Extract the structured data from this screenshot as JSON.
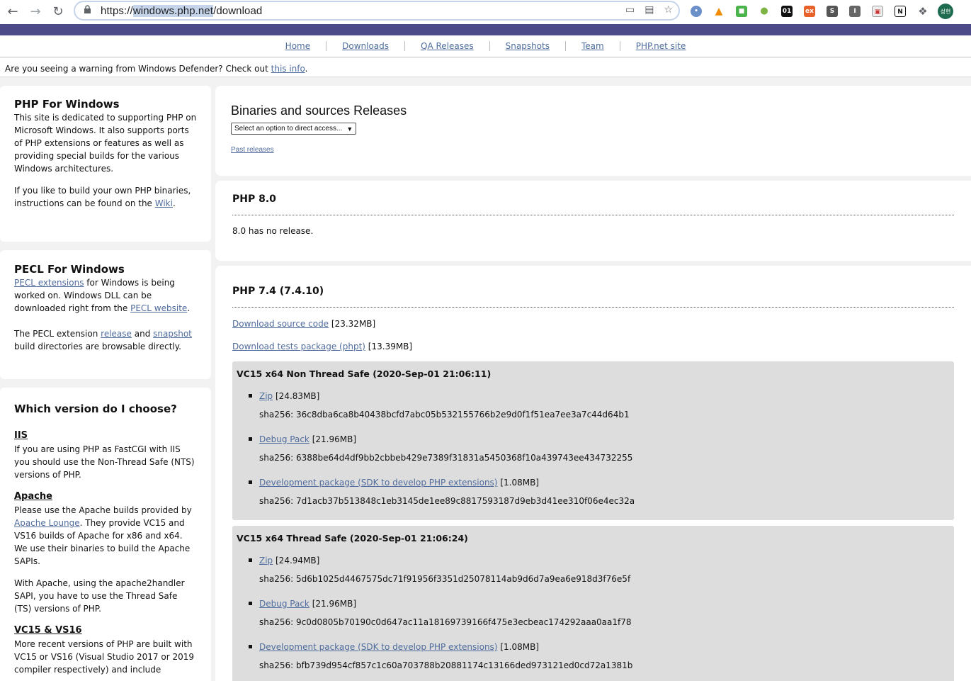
{
  "browser": {
    "url_prefix": "https://",
    "url_host": "windows.php.net",
    "url_path": "/download",
    "avatar_text": "성현",
    "icons": [
      "back-icon",
      "forward-icon",
      "reload-icon",
      "lock-icon",
      "cast-icon",
      "translate-icon",
      "star-icon",
      "extensions-icon"
    ]
  },
  "nav": {
    "items": [
      "Home",
      "Downloads",
      "QA Releases",
      "Snapshots",
      "Team",
      "PHP.net site"
    ]
  },
  "notice": {
    "text": "Are you seeing a warning from Windows Defender? Check out ",
    "link": "this info",
    "end": "."
  },
  "sidebar": {
    "php_windows": {
      "title": "PHP For Windows",
      "p1": "This site is dedicated to supporting PHP on Microsoft Windows. It also supports ports of PHP extensions or features as well as providing special builds for the various Windows architectures.",
      "p2_a": "If you like to build your own PHP binaries, instructions can be found on the ",
      "p2_link": "Wiki",
      "p2_b": "."
    },
    "pecl": {
      "title": "PECL For Windows",
      "p1_link1": "PECL extensions",
      "p1_a": " for Windows is being worked on. Windows DLL can be downloaded right from the ",
      "p1_link2": "PECL website",
      "p1_b": ".",
      "p2_a": "The PECL extension ",
      "p2_link1": "release",
      "p2_mid": " and ",
      "p2_link2": "snapshot",
      "p2_b": " build directories are browsable directly."
    },
    "choose": {
      "title": "Which version do I choose?",
      "iis_title": "IIS",
      "iis_text": "If you are using PHP as FastCGI with IIS you should use the Non-Thread Safe (NTS) versions of PHP.",
      "apache_title": "Apache",
      "apache_a": "Please use the Apache builds provided by ",
      "apache_link": "Apache Lounge",
      "apache_b": ". They provide VC15 and VS16 builds of Apache for x86 and x64. We use their binaries to build the Apache SAPIs.",
      "apache_p2": "With Apache, using the apache2handler SAPI, you have to use the Thread Safe (TS) versions of PHP.",
      "vc_title": "VC15 & VS16",
      "vc_text": "More recent versions of PHP are built with VC15 or VS16 (Visual Studio 2017 or 2019 compiler respectively) and include"
    }
  },
  "main": {
    "releases_title": "Binaries and sources Releases",
    "select_placeholder": "Select an option to direct access...",
    "past_releases": "Past releases",
    "php80": {
      "title": "PHP 8.0",
      "text": "8.0 has no release."
    },
    "php74": {
      "title": "PHP 7.4 (7.4.10)",
      "source_link": "Download source code",
      "source_size": "[23.32MB]",
      "tests_link": "Download tests package (phpt)",
      "tests_size": "[13.39MB]",
      "builds": [
        {
          "title": "VC15 x64 Non Thread Safe (2020-Sep-01 21:06:11)",
          "items": [
            {
              "label": "Zip",
              "size": "[24.83MB]",
              "sha": "sha256: 36c8dba6ca8b40438bcfd7abc05b532155766b2e9d0f1f51ea7ee3a7c44d64b1"
            },
            {
              "label": "Debug Pack",
              "size": "[21.96MB]",
              "sha": "sha256: 6388be64d4df9bb2cbbeb429e7389f31831a5450368f10a439743ee434732255"
            },
            {
              "label": "Development package (SDK to develop PHP extensions)",
              "size": "[1.08MB]",
              "sha": "sha256: 7d1acb37b513848c1eb3145de1ee89c8817593187d9eb3d41ee310f06e4ec32a"
            }
          ]
        },
        {
          "title": "VC15 x64 Thread Safe (2020-Sep-01 21:06:24)",
          "items": [
            {
              "label": "Zip",
              "size": "[24.94MB]",
              "sha": "sha256: 5d6b1025d4467575dc71f91956f3351d25078114ab9d6d7a9ea6e918d3f76e5f"
            },
            {
              "label": "Debug Pack",
              "size": "[21.96MB]",
              "sha": "sha256: 9c0d0805b70190c0d647ac11a18169739166f475e3ecbeac174292aaa0aa1f78"
            },
            {
              "label": "Development package (SDK to develop PHP extensions)",
              "size": "[1.08MB]",
              "sha": "sha256: bfb739d954cf857c1c60a703788b20881174c13166ded973121ed0cd72a1381b"
            }
          ]
        }
      ]
    }
  }
}
